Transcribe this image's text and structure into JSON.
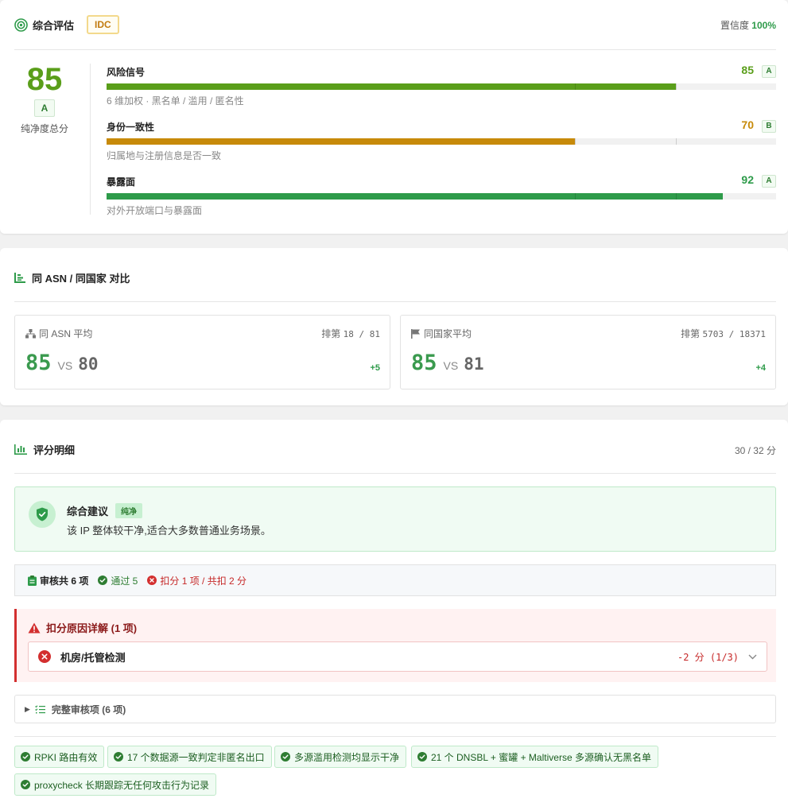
{
  "overview": {
    "title": "综合评估",
    "badge": "IDC",
    "confidence_label": "置信度",
    "confidence_value": "100%",
    "total_score": "85",
    "total_grade": "A",
    "total_label": "纯净度总分",
    "metrics": [
      {
        "name": "风险信号",
        "score": "85",
        "grade": "A",
        "fill_fraction": 0.85,
        "color": "#5a9e1a",
        "desc": "6 维加权 · 黑名单 / 滥用 / 匿名性"
      },
      {
        "name": "身份一致性",
        "score": "70",
        "grade": "B",
        "fill_fraction": 0.7,
        "color": "#c78a0a",
        "desc": "归属地与注册信息是否一致"
      },
      {
        "name": "暴露面",
        "score": "92",
        "grade": "A",
        "fill_fraction": 0.92,
        "color": "#2e9b4a",
        "desc": "对外开放端口与暴露面"
      }
    ],
    "score_colors": [
      "#5a9e1a",
      "#c78a0a",
      "#2e9b4a"
    ]
  },
  "comparison": {
    "title": "同 ASN / 同国家 对比",
    "asn": {
      "label": "同 ASN 平均",
      "rank_label": "排第",
      "rank": "18 / 81",
      "value": "85",
      "vs": "VS",
      "avg": "80",
      "delta": "+5"
    },
    "country": {
      "label": "同国家平均",
      "rank_label": "排第",
      "rank": "5703 / 18371",
      "value": "85",
      "vs": "VS",
      "avg": "81",
      "delta": "+4"
    }
  },
  "details": {
    "title": "评分明细",
    "score": "30 / 32 分",
    "advice": {
      "title": "综合建议",
      "tag": "纯净",
      "text": "该 IP 整体较干净,适合大多数普通业务场景。"
    },
    "audit": {
      "total": "审核共 6 项",
      "passed": "通过 5",
      "deducted": "扣分 1 项 / 共扣 2 分"
    },
    "deduction": {
      "title": "扣分原因详解 (1 项)",
      "item_name": "机房/托管检测",
      "item_points": "-2 分 (1/3)"
    },
    "full_audit": "完整审核项 (6 项)",
    "checks": [
      "RPKI 路由有效",
      "17 个数据源一致判定非匿名出口",
      "多源滥用检测均显示干净",
      "21 个 DNSBL + 蜜罐 + Maltiverse 多源确认无黑名单",
      "proxycheck 长期跟踪无任何攻击行为记录"
    ]
  }
}
